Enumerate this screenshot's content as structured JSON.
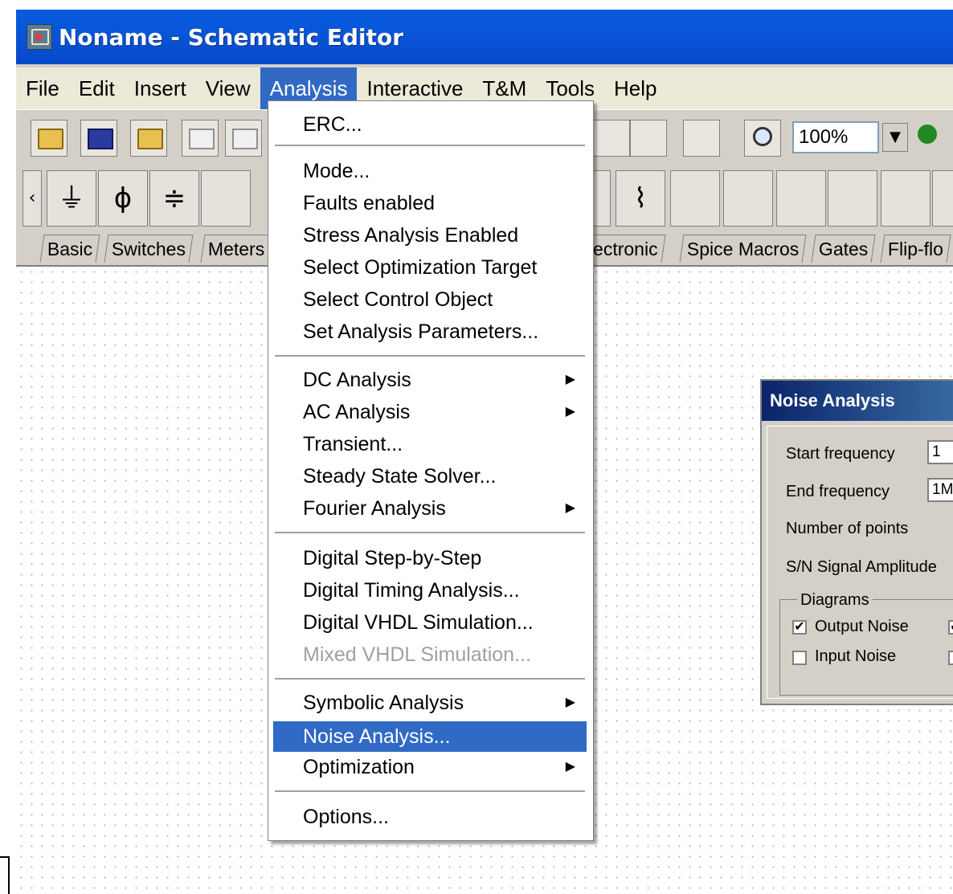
{
  "window": {
    "title": "Noname - Schematic Editor"
  },
  "menubar": {
    "items": [
      "File",
      "Edit",
      "Insert",
      "View",
      "Analysis",
      "Interactive",
      "T&M",
      "Tools",
      "Help"
    ],
    "active": "Analysis"
  },
  "toolbar": {
    "zoom_value": "100%"
  },
  "component_tabs": [
    "Basic",
    "Switches",
    "Meters",
    "lectronic",
    "Spice Macros",
    "Gates",
    "Flip-flo"
  ],
  "analysis_menu": {
    "erc": "ERC...",
    "mode": "Mode...",
    "faults": "Faults enabled",
    "stress": "Stress Analysis Enabled",
    "opt_target": "Select Optimization Target",
    "control_object": "Select Control Object",
    "set_params": "Set Analysis Parameters...",
    "dc": "DC Analysis",
    "ac": "AC Analysis",
    "transient": "Transient...",
    "steady": "Steady State Solver...",
    "fourier": "Fourier Analysis",
    "dig_step": "Digital Step-by-Step",
    "dig_timing": "Digital Timing Analysis...",
    "dig_vhdl": "Digital VHDL Simulation...",
    "mixed_vhdl": "Mixed VHDL Simulation...",
    "symbolic": "Symbolic Analysis",
    "noise": "Noise Analysis...",
    "optimization": "Optimization",
    "options": "Options..."
  },
  "noise_dialog": {
    "title": "Noise Analysis",
    "start_freq_label": "Start frequency",
    "start_freq_value": "1",
    "end_freq_label": "End frequency",
    "end_freq_value": "1M",
    "num_points_label": "Number of points",
    "sn_label": "S/N Signal Amplitude",
    "diagrams_label": "Diagrams",
    "output_noise_label": "Output Noise",
    "input_noise_label": "Input Noise"
  }
}
